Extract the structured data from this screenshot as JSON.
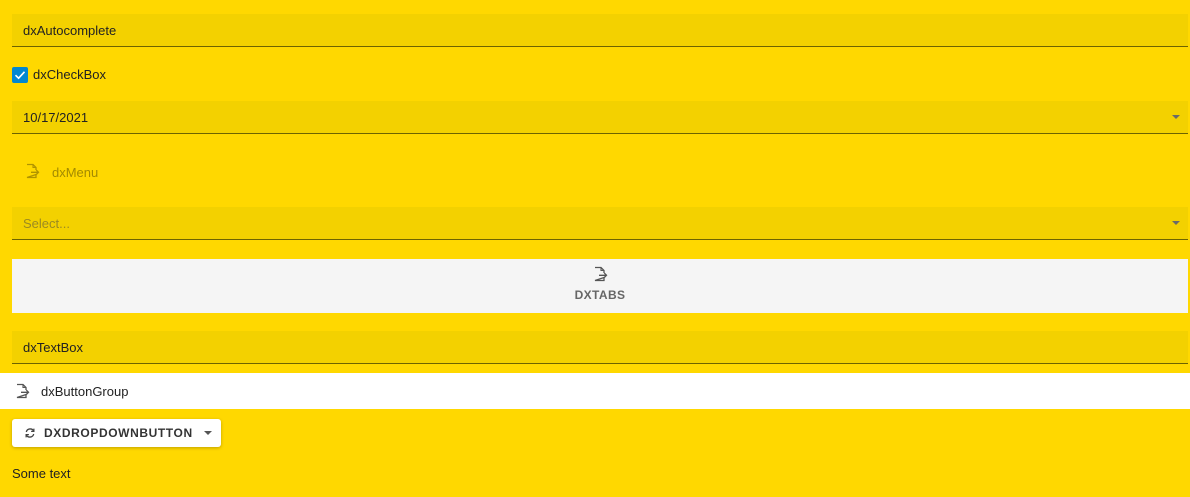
{
  "autocomplete": {
    "value": "dxAutocomplete"
  },
  "checkbox": {
    "label": "dxCheckBox",
    "checked": true
  },
  "datebox": {
    "value": "10/17/2021"
  },
  "menu": {
    "item_label": "dxMenu",
    "icon": "export-icon"
  },
  "selectbox": {
    "placeholder": "Select..."
  },
  "tabs": {
    "items": [
      {
        "label": "DXTABS",
        "icon": "export-icon"
      }
    ]
  },
  "textbox": {
    "value": "dxTextBox"
  },
  "button_group": {
    "items": [
      {
        "label": "dxButtonGroup",
        "icon": "export-icon"
      }
    ]
  },
  "dropdown_button": {
    "label": "DXDROPDOWNBUTTON",
    "icon": "refresh-icon"
  },
  "footer": {
    "text": "Some text"
  },
  "colors": {
    "background": "#ffd800",
    "field": "#f3d100",
    "accent": "#0288d1"
  }
}
